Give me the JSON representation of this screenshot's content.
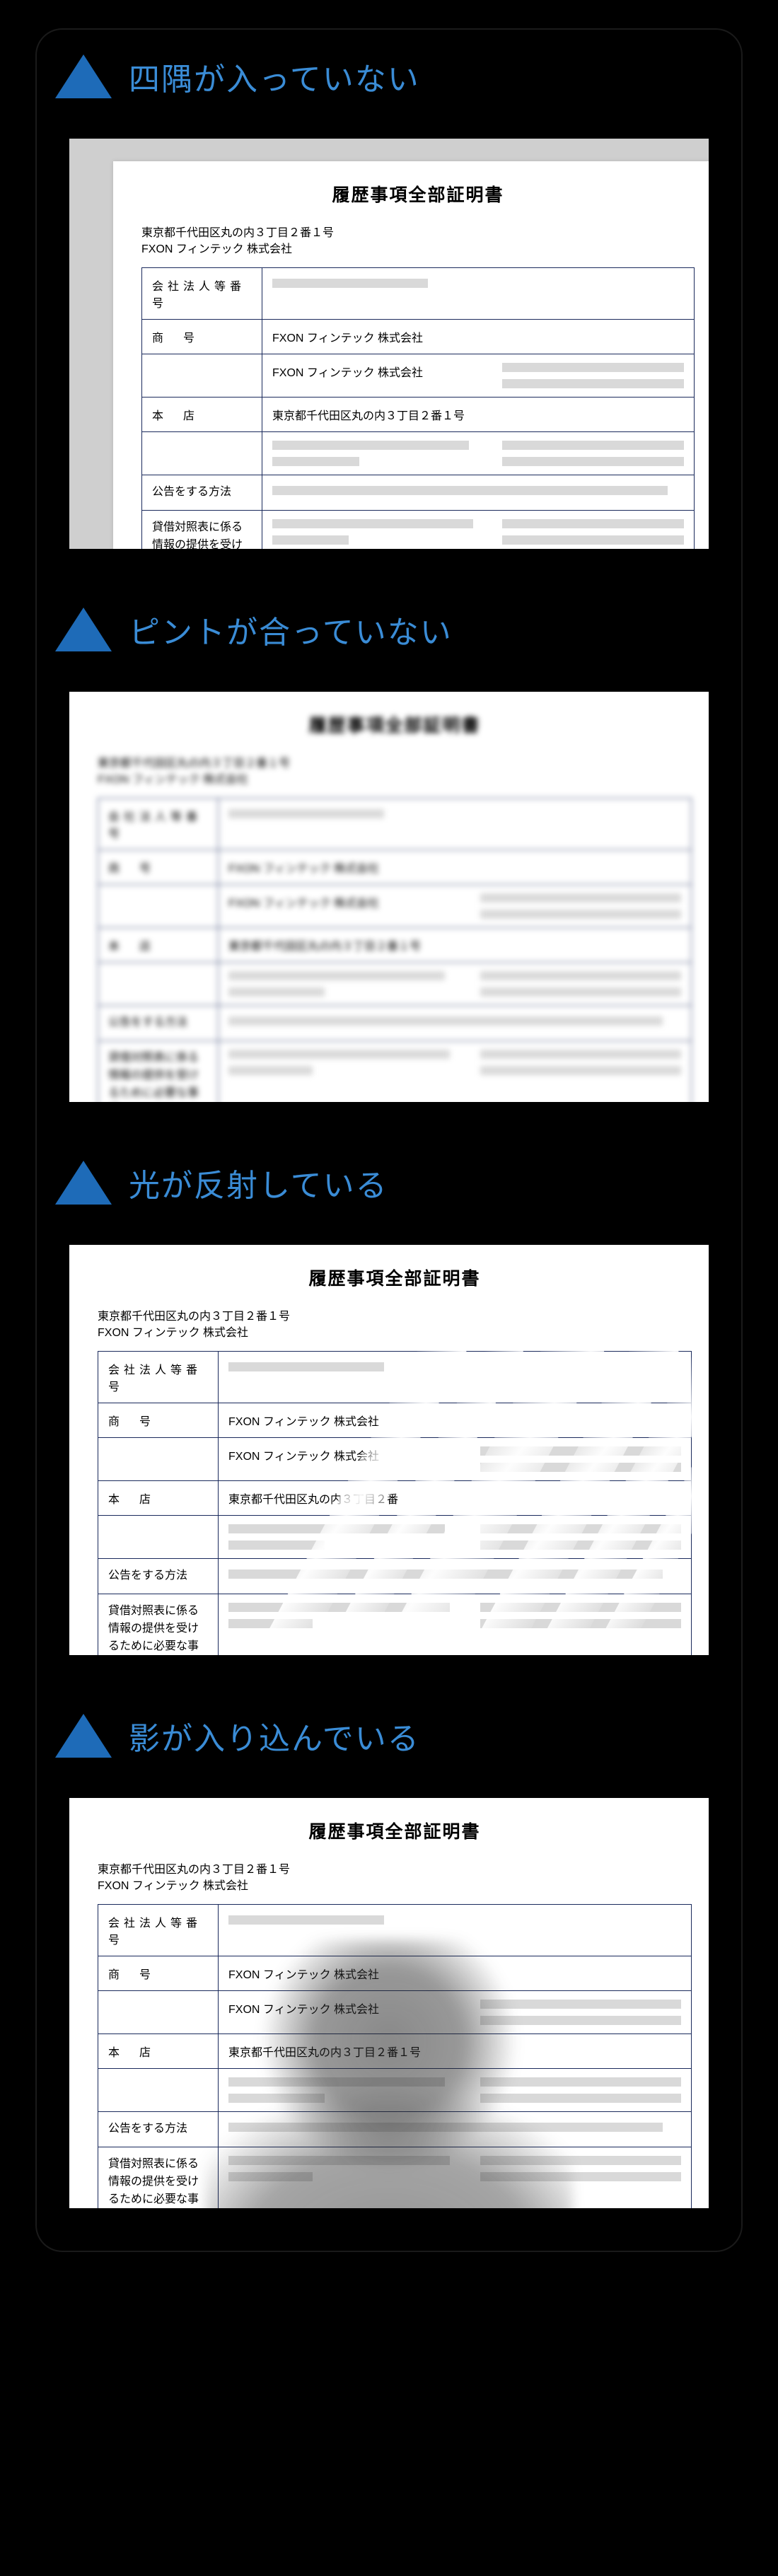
{
  "headings": {
    "cropped": "四隅が入っていない",
    "blur": "ピントが合っていない",
    "glare": "光が反射している",
    "shadow": "影が入り込んでいる"
  },
  "doc": {
    "title": "履歴事項全部証明書",
    "address_line1": "東京都千代田区丸の内３丁目２番１号",
    "address_line2": "FXON フィンテック 株式会社",
    "rows": {
      "corp_num": "会社法人等番号",
      "trade_name": "商　号",
      "head_office": "本　店",
      "notice_method": "公告をする方法",
      "balance_info": "貸借対照表に係る情報の提供を受けるために必要な事項"
    },
    "values": {
      "trade_name": "FXON フィンテック 株式会社",
      "trade_name_sub": "FXON フィンテック 株式会社",
      "head_office": "東京都千代田区丸の内３丁目２番１号",
      "head_office_glare": "東京都千代田区丸の内３丁目２番"
    }
  }
}
